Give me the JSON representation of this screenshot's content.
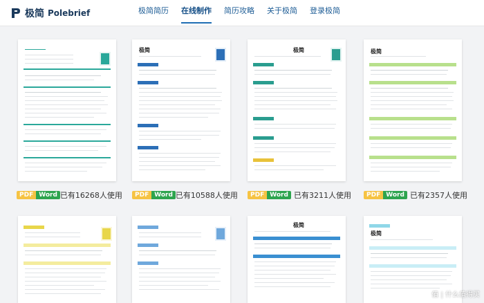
{
  "header": {
    "logo_cn": "极简",
    "logo_en": "Polebrief",
    "nav": [
      "极简简历",
      "在线制作",
      "简历攻略",
      "关于极简",
      "登录极简"
    ]
  },
  "cards": [
    {
      "name": "",
      "accent": "#2aa89a",
      "pdf": "PDF",
      "word": "Word",
      "used": "已有16268人使用"
    },
    {
      "name": "极简",
      "accent": "#2c6fb7",
      "pdf": "PDF",
      "word": "Word",
      "used": "已有10588人使用"
    },
    {
      "name": "极简",
      "accent": "#2a9d8f",
      "pdf": "PDF",
      "word": "Word",
      "used": "已有3211人使用"
    },
    {
      "name": "极简",
      "accent": "#7ac943",
      "pdf": "PDF",
      "word": "Word",
      "used": "已有2357人使用"
    }
  ],
  "cards_row2": [
    {
      "name": "",
      "accent": "#e8d64a"
    },
    {
      "name": "",
      "accent": "#6fa8dc"
    },
    {
      "name": "极简",
      "accent": "#3a8fd1"
    },
    {
      "name": "极简",
      "accent": "#8fd7e8"
    }
  ],
  "watermark": "值 | 什么值得买"
}
